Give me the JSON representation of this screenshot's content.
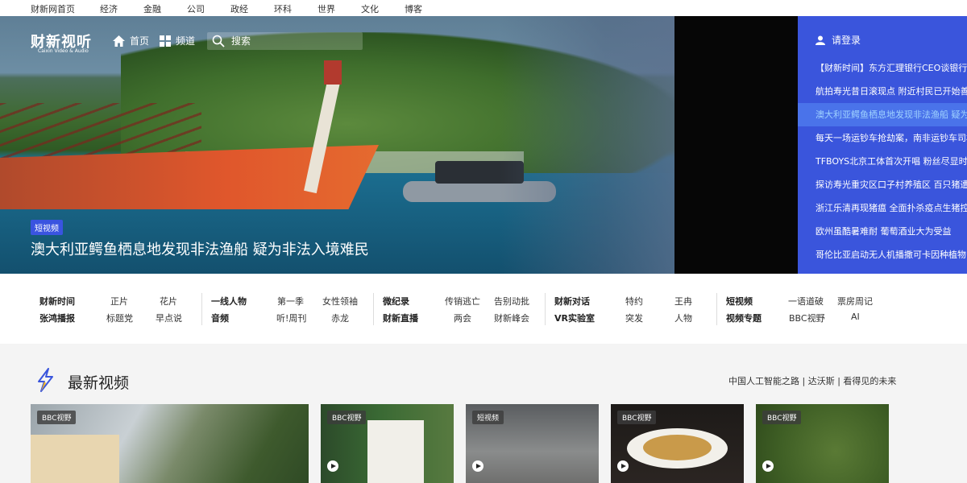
{
  "topnav": [
    "财新网首页",
    "经济",
    "金融",
    "公司",
    "政经",
    "环科",
    "世界",
    "文化",
    "博客"
  ],
  "brand": {
    "logo": "财新视听",
    "sub": "Caixin Video & Audio"
  },
  "hero_nav": {
    "home": "首页",
    "channel": "频道",
    "search_placeholder": "搜索"
  },
  "hero": {
    "tag": "短视频",
    "title": "澳大利亚鳄鱼栖息地发现非法渔船 疑为非法入境难民"
  },
  "right_panel": {
    "login": "请登录",
    "news": [
      "【财新时间】东方汇理银行CEO谈银行业",
      "航拍寿光昔日滚现点 附近村民已开始善后",
      "澳大利亚鳄鱼栖息地发现非法渔船 疑为非",
      "每天一场运钞车抢劫案，南非运钞车司机",
      "TFBOYS北京工体首次开唱 粉丝尽显时代",
      "探访寿光重灾区口子村养殖区 百只猪遭灭",
      "浙江乐清再现猪瘟 全面扑杀疫点生猪控制",
      "欧州虽酷暑难耐 葡萄酒业大为受益",
      "哥伦比亚启动无人机播撒可卡因种植物"
    ]
  },
  "categories": {
    "col1": {
      "row1": [
        "财新时间",
        "正片",
        "花片"
      ],
      "row2": [
        "张鸿播报",
        "标题党",
        "早点说"
      ]
    },
    "col2": {
      "row1": [
        "一线人物",
        "第一季",
        "女性领袖"
      ],
      "row2": [
        "音频",
        "听!周刊",
        "赤龙"
      ]
    },
    "col3": {
      "row1": [
        "微纪录",
        "传销逃亡",
        "告别动批"
      ],
      "row2": [
        "财新直播",
        "两会",
        "财新峰会"
      ]
    },
    "col4": {
      "row1": [
        "财新对话",
        "特约",
        "王冉"
      ],
      "row2": [
        "VR实验室",
        "突发",
        "人物"
      ]
    },
    "col5": {
      "row1": [
        "短视频",
        "一语道破",
        "票房周记"
      ],
      "row2": [
        "视频专题",
        "BBC视野",
        "AI"
      ]
    }
  },
  "latest": {
    "title": "最新视频",
    "right_link": "中国人工智能之路 | 达沃斯 | 看得见的未来",
    "thumbs": [
      "BBC视野",
      "BBC视野",
      "短视频",
      "BBC视野",
      "BBC视野"
    ]
  }
}
